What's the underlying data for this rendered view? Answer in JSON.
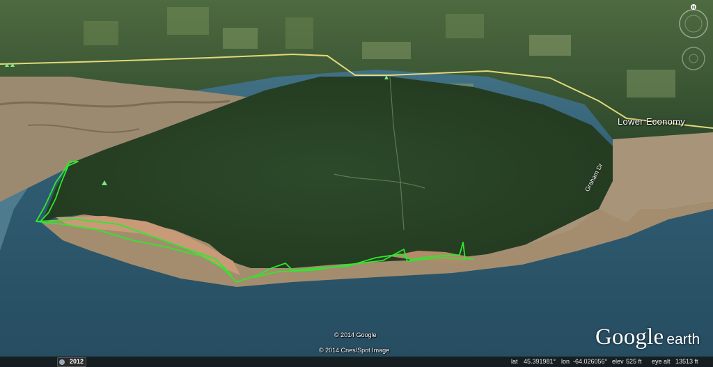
{
  "map": {
    "place_label": "Lower Economy",
    "road_label": "Graham Dr",
    "credits": [
      "© 2014 Google",
      "© 2014 Cnes/Spot Image"
    ],
    "brand": {
      "google": "Google",
      "earth": "earth"
    },
    "compass_north": "N",
    "colors": {
      "track": "#2ee82e",
      "highway": "#e3d87a",
      "water": "#2f5a6e",
      "forest": "#2d4a2a",
      "tidal_flat": "#a08c72",
      "cliff": "#c99a78"
    }
  },
  "statusbar": {
    "imagery_year": "2012",
    "lat_label": "lat",
    "lat_value": "45.391981°",
    "lon_label": "lon",
    "lon_value": "-64.026056°",
    "elev_label": "elev",
    "elev_value": "525 ft",
    "eye_alt_label": "eye alt",
    "eye_alt_value": "13513 ft"
  }
}
